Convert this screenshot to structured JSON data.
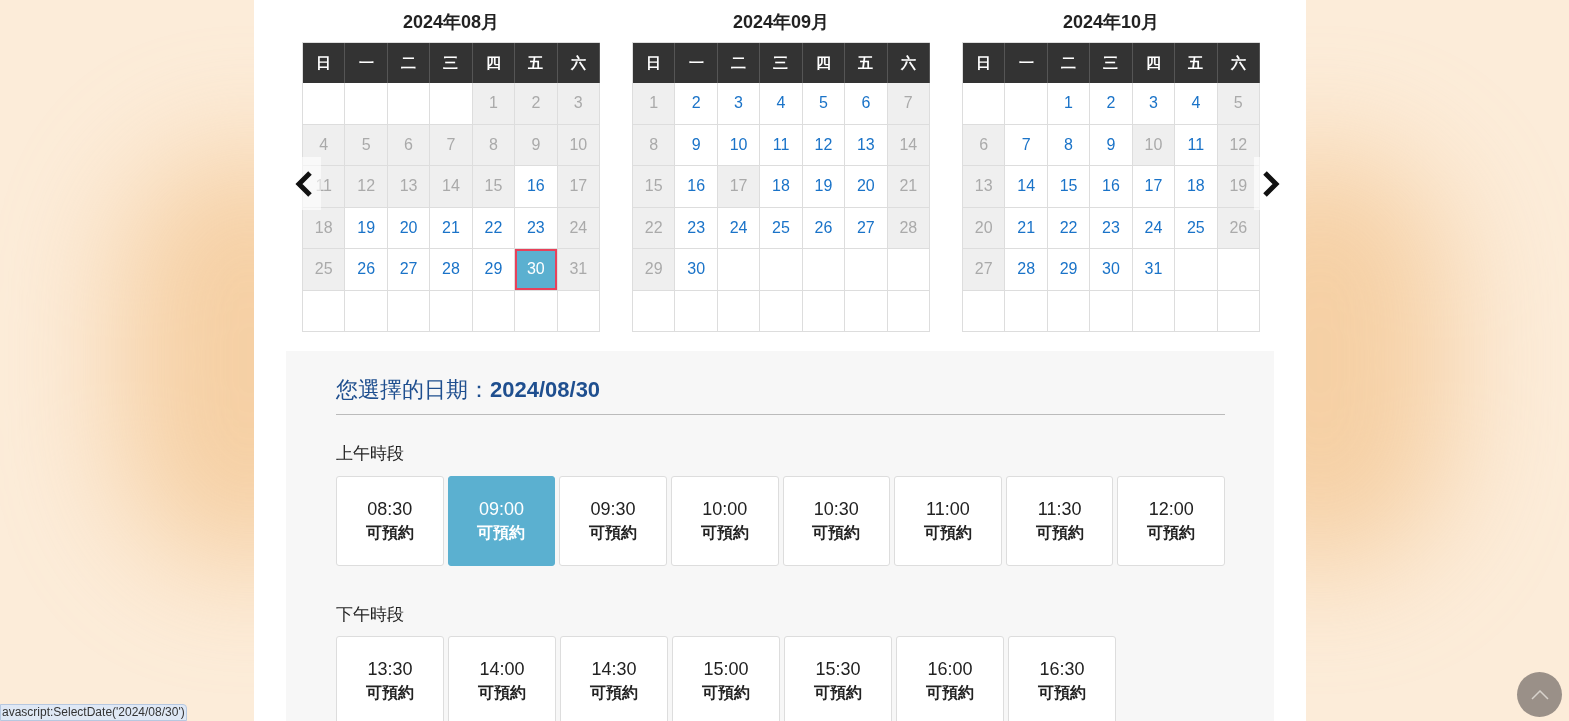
{
  "calendars": [
    {
      "title": "2024年08月",
      "weekdays": [
        "日",
        "一",
        "二",
        "三",
        "四",
        "五",
        "六"
      ],
      "weeks": [
        [
          {
            "kind": "empty"
          },
          {
            "kind": "empty"
          },
          {
            "kind": "empty"
          },
          {
            "kind": "empty"
          },
          {
            "day": "1",
            "kind": "off",
            "selected": false
          },
          {
            "day": "2",
            "kind": "off",
            "selected": false
          },
          {
            "day": "3",
            "kind": "off",
            "selected": false
          }
        ],
        [
          {
            "day": "4",
            "kind": "off",
            "selected": false
          },
          {
            "day": "5",
            "kind": "off",
            "selected": false
          },
          {
            "day": "6",
            "kind": "off",
            "selected": false
          },
          {
            "day": "7",
            "kind": "off",
            "selected": false
          },
          {
            "day": "8",
            "kind": "off",
            "selected": false
          },
          {
            "day": "9",
            "kind": "off",
            "selected": false
          },
          {
            "day": "10",
            "kind": "off",
            "selected": false
          }
        ],
        [
          {
            "day": "11",
            "kind": "off",
            "selected": false
          },
          {
            "day": "12",
            "kind": "off",
            "selected": false
          },
          {
            "day": "13",
            "kind": "off",
            "selected": false
          },
          {
            "day": "14",
            "kind": "off",
            "selected": false
          },
          {
            "day": "15",
            "kind": "off",
            "selected": false
          },
          {
            "day": "16",
            "kind": "open",
            "selected": false
          },
          {
            "day": "17",
            "kind": "off",
            "selected": false
          }
        ],
        [
          {
            "day": "18",
            "kind": "off",
            "selected": false
          },
          {
            "day": "19",
            "kind": "open",
            "selected": false
          },
          {
            "day": "20",
            "kind": "open",
            "selected": false
          },
          {
            "day": "21",
            "kind": "open",
            "selected": false
          },
          {
            "day": "22",
            "kind": "open",
            "selected": false
          },
          {
            "day": "23",
            "kind": "open",
            "selected": false
          },
          {
            "day": "24",
            "kind": "off",
            "selected": false
          }
        ],
        [
          {
            "day": "25",
            "kind": "off",
            "selected": false
          },
          {
            "day": "26",
            "kind": "open",
            "selected": false
          },
          {
            "day": "27",
            "kind": "open",
            "selected": false
          },
          {
            "day": "28",
            "kind": "open",
            "selected": false
          },
          {
            "day": "29",
            "kind": "open",
            "selected": false
          },
          {
            "day": "30",
            "kind": "open",
            "selected": true
          },
          {
            "day": "31",
            "kind": "off",
            "selected": false
          }
        ],
        [
          {
            "kind": "empty"
          },
          {
            "kind": "empty"
          },
          {
            "kind": "empty"
          },
          {
            "kind": "empty"
          },
          {
            "kind": "empty"
          },
          {
            "kind": "empty"
          },
          {
            "kind": "empty"
          }
        ]
      ]
    },
    {
      "title": "2024年09月",
      "weekdays": [
        "日",
        "一",
        "二",
        "三",
        "四",
        "五",
        "六"
      ],
      "weeks": [
        [
          {
            "day": "1",
            "kind": "off",
            "selected": false
          },
          {
            "day": "2",
            "kind": "open",
            "selected": false
          },
          {
            "day": "3",
            "kind": "open",
            "selected": false
          },
          {
            "day": "4",
            "kind": "open",
            "selected": false
          },
          {
            "day": "5",
            "kind": "open",
            "selected": false
          },
          {
            "day": "6",
            "kind": "open",
            "selected": false
          },
          {
            "day": "7",
            "kind": "off",
            "selected": false
          }
        ],
        [
          {
            "day": "8",
            "kind": "off",
            "selected": false
          },
          {
            "day": "9",
            "kind": "open",
            "selected": false
          },
          {
            "day": "10",
            "kind": "open",
            "selected": false
          },
          {
            "day": "11",
            "kind": "open",
            "selected": false
          },
          {
            "day": "12",
            "kind": "open",
            "selected": false
          },
          {
            "day": "13",
            "kind": "open",
            "selected": false
          },
          {
            "day": "14",
            "kind": "off",
            "selected": false
          }
        ],
        [
          {
            "day": "15",
            "kind": "off",
            "selected": false
          },
          {
            "day": "16",
            "kind": "open",
            "selected": false
          },
          {
            "day": "17",
            "kind": "off",
            "selected": false
          },
          {
            "day": "18",
            "kind": "open",
            "selected": false
          },
          {
            "day": "19",
            "kind": "open",
            "selected": false
          },
          {
            "day": "20",
            "kind": "open",
            "selected": false
          },
          {
            "day": "21",
            "kind": "off",
            "selected": false
          }
        ],
        [
          {
            "day": "22",
            "kind": "off",
            "selected": false
          },
          {
            "day": "23",
            "kind": "open",
            "selected": false
          },
          {
            "day": "24",
            "kind": "open",
            "selected": false
          },
          {
            "day": "25",
            "kind": "open",
            "selected": false
          },
          {
            "day": "26",
            "kind": "open",
            "selected": false
          },
          {
            "day": "27",
            "kind": "open",
            "selected": false
          },
          {
            "day": "28",
            "kind": "off",
            "selected": false
          }
        ],
        [
          {
            "day": "29",
            "kind": "off",
            "selected": false
          },
          {
            "day": "30",
            "kind": "open",
            "selected": false
          },
          {
            "kind": "empty"
          },
          {
            "kind": "empty"
          },
          {
            "kind": "empty"
          },
          {
            "kind": "empty"
          },
          {
            "kind": "empty"
          }
        ],
        [
          {
            "kind": "empty"
          },
          {
            "kind": "empty"
          },
          {
            "kind": "empty"
          },
          {
            "kind": "empty"
          },
          {
            "kind": "empty"
          },
          {
            "kind": "empty"
          },
          {
            "kind": "empty"
          }
        ]
      ]
    },
    {
      "title": "2024年10月",
      "weekdays": [
        "日",
        "一",
        "二",
        "三",
        "四",
        "五",
        "六"
      ],
      "weeks": [
        [
          {
            "kind": "empty"
          },
          {
            "kind": "empty"
          },
          {
            "day": "1",
            "kind": "open",
            "selected": false
          },
          {
            "day": "2",
            "kind": "open",
            "selected": false
          },
          {
            "day": "3",
            "kind": "open",
            "selected": false
          },
          {
            "day": "4",
            "kind": "open",
            "selected": false
          },
          {
            "day": "5",
            "kind": "off",
            "selected": false
          }
        ],
        [
          {
            "day": "6",
            "kind": "off",
            "selected": false
          },
          {
            "day": "7",
            "kind": "open",
            "selected": false
          },
          {
            "day": "8",
            "kind": "open",
            "selected": false
          },
          {
            "day": "9",
            "kind": "open",
            "selected": false
          },
          {
            "day": "10",
            "kind": "off",
            "selected": false
          },
          {
            "day": "11",
            "kind": "open",
            "selected": false
          },
          {
            "day": "12",
            "kind": "off",
            "selected": false
          }
        ],
        [
          {
            "day": "13",
            "kind": "off",
            "selected": false
          },
          {
            "day": "14",
            "kind": "open",
            "selected": false
          },
          {
            "day": "15",
            "kind": "open",
            "selected": false
          },
          {
            "day": "16",
            "kind": "open",
            "selected": false
          },
          {
            "day": "17",
            "kind": "open",
            "selected": false
          },
          {
            "day": "18",
            "kind": "open",
            "selected": false
          },
          {
            "day": "19",
            "kind": "off",
            "selected": false
          }
        ],
        [
          {
            "day": "20",
            "kind": "off",
            "selected": false
          },
          {
            "day": "21",
            "kind": "open",
            "selected": false
          },
          {
            "day": "22",
            "kind": "open",
            "selected": false
          },
          {
            "day": "23",
            "kind": "open",
            "selected": false
          },
          {
            "day": "24",
            "kind": "open",
            "selected": false
          },
          {
            "day": "25",
            "kind": "open",
            "selected": false
          },
          {
            "day": "26",
            "kind": "off",
            "selected": false
          }
        ],
        [
          {
            "day": "27",
            "kind": "off",
            "selected": false
          },
          {
            "day": "28",
            "kind": "open",
            "selected": false
          },
          {
            "day": "29",
            "kind": "open",
            "selected": false
          },
          {
            "day": "30",
            "kind": "open",
            "selected": false
          },
          {
            "day": "31",
            "kind": "open",
            "selected": false
          },
          {
            "kind": "empty"
          },
          {
            "kind": "empty"
          }
        ],
        [
          {
            "kind": "empty"
          },
          {
            "kind": "empty"
          },
          {
            "kind": "empty"
          },
          {
            "kind": "empty"
          },
          {
            "kind": "empty"
          },
          {
            "kind": "empty"
          },
          {
            "kind": "empty"
          }
        ]
      ]
    }
  ],
  "selection": {
    "label": "您選擇的日期：",
    "date": "2024/08/30"
  },
  "periods": [
    {
      "title": "上午時段",
      "slots": [
        {
          "time": "08:30",
          "status": "可預約",
          "selected": false
        },
        {
          "time": "09:00",
          "status": "可預約",
          "selected": true
        },
        {
          "time": "09:30",
          "status": "可預約",
          "selected": false
        },
        {
          "time": "10:00",
          "status": "可預約",
          "selected": false
        },
        {
          "time": "10:30",
          "status": "可預約",
          "selected": false
        },
        {
          "time": "11:00",
          "status": "可預約",
          "selected": false
        },
        {
          "time": "11:30",
          "status": "可預約",
          "selected": false
        },
        {
          "time": "12:00",
          "status": "可預約",
          "selected": false
        }
      ]
    },
    {
      "title": "下午時段",
      "slots": [
        {
          "time": "13:30",
          "status": "可預約",
          "selected": false
        },
        {
          "time": "14:00",
          "status": "可預約",
          "selected": false
        },
        {
          "time": "14:30",
          "status": "可預約",
          "selected": false
        },
        {
          "time": "15:00",
          "status": "可預約",
          "selected": false
        },
        {
          "time": "15:30",
          "status": "可預約",
          "selected": false
        },
        {
          "time": "16:00",
          "status": "可預約",
          "selected": false
        },
        {
          "time": "16:30",
          "status": "可預約",
          "selected": false
        }
      ]
    }
  ],
  "status_bar": {
    "text": "avascript:SelectDate('2024/08/30')"
  }
}
